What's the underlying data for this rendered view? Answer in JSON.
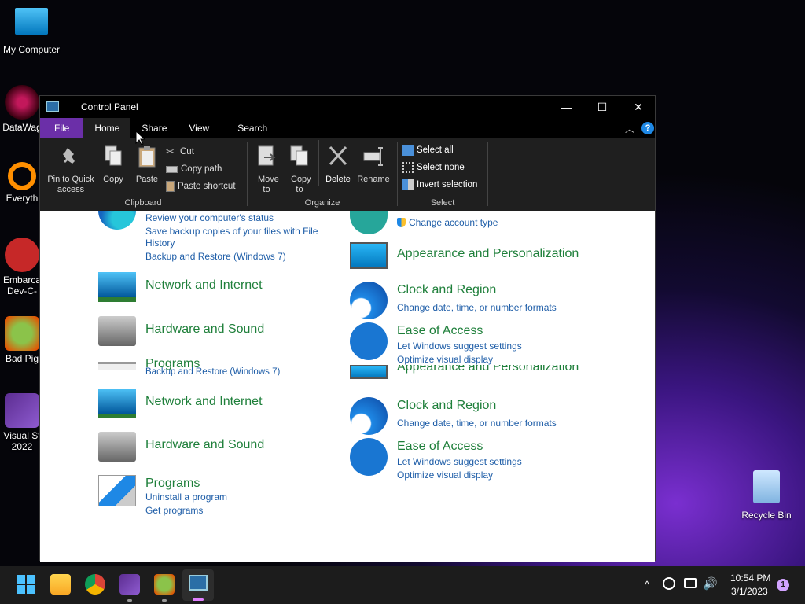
{
  "desktop": {
    "icons": [
      {
        "label": "My Computer"
      },
      {
        "label": "DataWag"
      },
      {
        "label": "Everyth"
      },
      {
        "label": "Embarca Dev-C-"
      },
      {
        "label": "Bad Pig"
      },
      {
        "label": "Visual St 2022"
      },
      {
        "label": "Recycle Bin"
      }
    ]
  },
  "window": {
    "title": "Control Panel",
    "controls": {
      "minimize": "—",
      "maximize": "☐",
      "close": "✕"
    }
  },
  "ribbon": {
    "tabs": [
      "File",
      "Home",
      "Share",
      "View",
      "Search"
    ],
    "help": "?",
    "clipboard": {
      "label": "Clipboard",
      "pin": "Pin to Quick access",
      "copy": "Copy",
      "paste": "Paste",
      "cut": "Cut",
      "copy_path": "Copy path",
      "paste_shortcut": "Paste shortcut"
    },
    "organize": {
      "label": "Organize",
      "move_to": "Move to",
      "copy_to": "Copy to",
      "delete": "Delete",
      "rename": "Rename"
    },
    "select": {
      "label": "Select",
      "select_all": "Select all",
      "select_none": "Select none",
      "invert": "Invert selection"
    }
  },
  "content": {
    "system_links": [
      "Review your computer's status",
      "Save backup copies of your files with File",
      "History",
      "Backup and Restore (Windows 7)"
    ],
    "change_account_type": "Change account type",
    "network": {
      "title": "Network and Internet"
    },
    "hardware": {
      "title": "Hardware and Sound"
    },
    "programs": {
      "title": "Programs",
      "links": [
        "Uninstall a program",
        "Get programs"
      ]
    },
    "ghost_backup": "Backup and Restore (Windows 7)",
    "appearance": {
      "title": "Appearance and Personalization"
    },
    "clock": {
      "title": "Clock and Region",
      "links": [
        "Change date, time, or number formats"
      ]
    },
    "ease": {
      "title": "Ease of Access",
      "links": [
        "Let Windows suggest settings",
        "Optimize visual display"
      ]
    }
  },
  "taskbar": {
    "time": "10:54 PM",
    "date": "3/1/2023",
    "notification_count": "1",
    "tray_chevron": "^"
  }
}
